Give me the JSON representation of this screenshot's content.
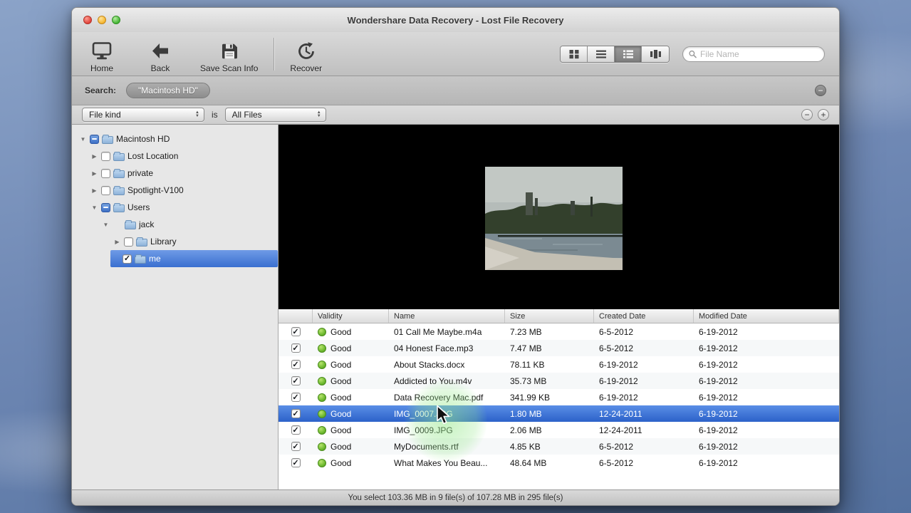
{
  "window": {
    "title": "Wondershare Data Recovery - Lost File Recovery"
  },
  "toolbar": {
    "buttons": [
      {
        "label": "Home"
      },
      {
        "label": "Back"
      },
      {
        "label": "Save Scan Info"
      },
      {
        "label": "Recover"
      }
    ],
    "search_placeholder": "File Name"
  },
  "search_bar": {
    "label": "Search:",
    "token": "\"Macintosh HD\""
  },
  "filter_bar": {
    "field": "File kind",
    "connector": "is",
    "value": "All Files"
  },
  "sidebar": {
    "items": [
      {
        "label": "Macintosh HD",
        "level": 0,
        "disclosure": "open",
        "checkbox": "mixed",
        "selected": false
      },
      {
        "label": "Lost Location",
        "level": 1,
        "disclosure": "closed",
        "checkbox": "empty",
        "selected": false
      },
      {
        "label": "private",
        "level": 1,
        "disclosure": "closed",
        "checkbox": "empty",
        "selected": false
      },
      {
        "label": "Spotlight-V100",
        "level": 1,
        "disclosure": "closed",
        "checkbox": "empty",
        "selected": false
      },
      {
        "label": "Users",
        "level": 1,
        "disclosure": "open",
        "checkbox": "mixed",
        "selected": false
      },
      {
        "label": "jack",
        "level": 2,
        "disclosure": "open",
        "checkbox": "none",
        "selected": false
      },
      {
        "label": "Library",
        "level": 3,
        "disclosure": "closed",
        "checkbox": "empty",
        "selected": false
      },
      {
        "label": "me",
        "level": 3,
        "disclosure": "none",
        "checkbox": "checked",
        "selected": true
      }
    ]
  },
  "table": {
    "columns": [
      "Validity",
      "Name",
      "Size",
      "Created Date",
      "Modified Date"
    ],
    "rows": [
      {
        "validity": "Good",
        "name": "01 Call Me Maybe.m4a",
        "size": "7.23 MB",
        "created": "6-5-2012",
        "modified": "6-19-2012",
        "selected": false
      },
      {
        "validity": "Good",
        "name": "04 Honest Face.mp3",
        "size": "7.47 MB",
        "created": "6-5-2012",
        "modified": "6-19-2012",
        "selected": false
      },
      {
        "validity": "Good",
        "name": "About Stacks.docx",
        "size": "78.11 KB",
        "created": "6-19-2012",
        "modified": "6-19-2012",
        "selected": false
      },
      {
        "validity": "Good",
        "name": "Addicted to You.m4v",
        "size": "35.73 MB",
        "created": "6-19-2012",
        "modified": "6-19-2012",
        "selected": false
      },
      {
        "validity": "Good",
        "name": "Data Recovery Mac.pdf",
        "size": "341.99 KB",
        "created": "6-19-2012",
        "modified": "6-19-2012",
        "selected": false
      },
      {
        "validity": "Good",
        "name": "IMG_0007.JPG",
        "size": "1.80 MB",
        "created": "12-24-2011",
        "modified": "6-19-2012",
        "selected": true
      },
      {
        "validity": "Good",
        "name": "IMG_0009.JPG",
        "size": "2.06 MB",
        "created": "12-24-2011",
        "modified": "6-19-2012",
        "selected": false
      },
      {
        "validity": "Good",
        "name": "MyDocuments.rtf",
        "size": "4.85 KB",
        "created": "6-5-2012",
        "modified": "6-19-2012",
        "selected": false
      },
      {
        "validity": "Good",
        "name": "What Makes You Beau...",
        "size": "48.64 MB",
        "created": "6-5-2012",
        "modified": "6-19-2012",
        "selected": false
      }
    ]
  },
  "status_bar": {
    "text": "You select 103.36 MB in 9 file(s) of 107.28 MB in 295 file(s)"
  }
}
